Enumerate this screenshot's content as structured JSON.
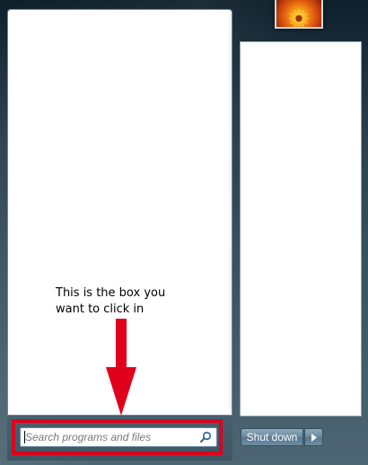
{
  "start_menu": {
    "search": {
      "placeholder": "Search programs and files",
      "value": ""
    },
    "annotation": {
      "line1": "This is the box you",
      "line2": "want to click in"
    },
    "shutdown": {
      "label": "Shut down"
    }
  },
  "icons": {
    "search": "magnifier-icon",
    "shutdown_menu": "triangle-right-icon",
    "user_picture": "flower-user-picture"
  },
  "colors": {
    "highlight": "#e0001b",
    "arrow": "#e0001b",
    "panel": "#ffffff"
  }
}
